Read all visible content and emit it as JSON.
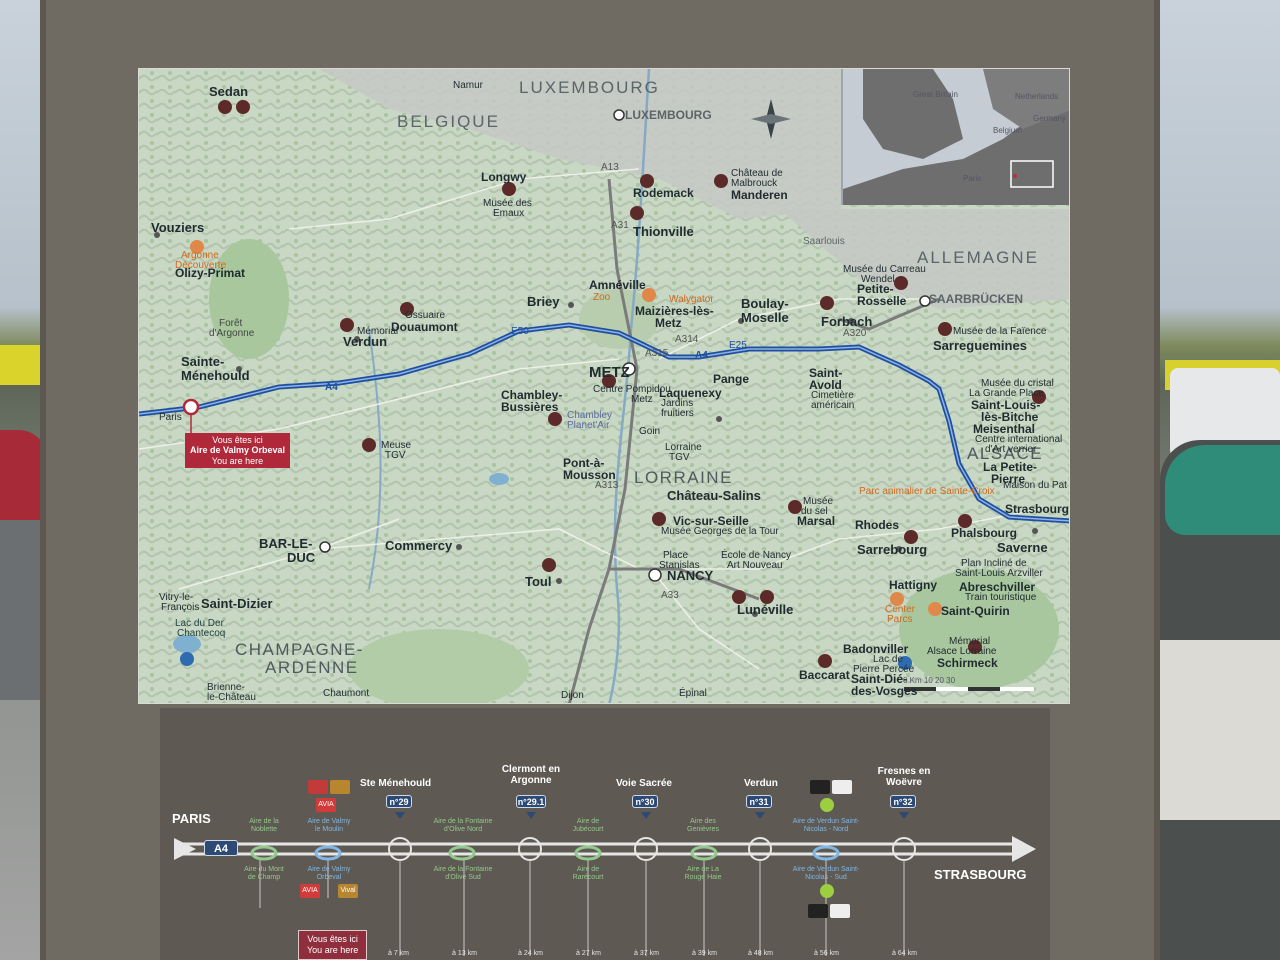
{
  "countries": {
    "luxembourg": "LUXEMBOURG",
    "belgique": "BELGIQUE",
    "allemagne": "ALLEMAGNE"
  },
  "regions": {
    "lorraine": "LORRAINE",
    "alsace": "ALSACE",
    "champagne": "CHAMPAGNE-",
    "ardenne": "ARDENNE"
  },
  "cities": {
    "sedan": "Sedan",
    "luxembourg_city": "LUXEMBOURG",
    "vouziers": "Vouziers",
    "olizy": "Olizy-Primat",
    "longwy": "Longwy",
    "rodemack": "Rodemack",
    "manderen": "Manderen",
    "thionville": "Thionville",
    "briey": "Briey",
    "amneville": "Amnéville",
    "maizieres": "Maizières-lès-",
    "maizieres2": "Metz",
    "boulay": "Boulay-",
    "boulay2": "Moselle",
    "forbach": "Forbach",
    "saarbrucken": "SAARBRÜCKEN",
    "verdun": "Verdun",
    "ste_men": "Sainte-",
    "ste_men2": "Ménehould",
    "metz": "METZ",
    "sarreguemines": "Sarreguemines",
    "chambley": "Chambley-",
    "chambley2": "Bussières",
    "laquenexy": "Laquenexy",
    "pange": "Pange",
    "st_avold": "Saint-",
    "st_avold2": "Avold",
    "pont_mousson": "Pont-à-",
    "pont_mousson2": "Mousson",
    "chateau_salins": "Château-Salins",
    "vic": "Vic-sur-Seille",
    "marsal": "Marsal",
    "rhodes": "Rhodes",
    "sarrebourg": "Sarrebourg",
    "phalsbourg": "Phalsbourg",
    "saverne": "Saverne",
    "strasbourg": "Strasbourg",
    "bar_le_duc": "BAR-LE-",
    "bar_le_duc2": "DUC",
    "commercy": "Commercy",
    "toul": "Toul",
    "nancy": "NANCY",
    "luneville": "Lunéville",
    "hattigny": "Hattigny",
    "abreschviller": "Abreschviller",
    "st_quirin": "Saint-Quirin",
    "st_dizier": "Saint-Dizier",
    "vitry": "Vitry-le-",
    "vitry2": "François",
    "badonviller": "Badonviller",
    "schirmeck": "Schirmeck",
    "baccarat": "Baccarat",
    "st_die": "Saint-Dié-",
    "st_die2": "des-Vosges",
    "chaumont": "Chaumont",
    "dijon": "Dijon",
    "epinal": "Épinal",
    "brienne": "Brienne-",
    "brienne2": "le-Château",
    "namur": "Namur",
    "saarlouis": "Saarlouis",
    "paris": "Paris",
    "la_petite": "La Petite-",
    "pierre": "Pierre"
  },
  "pois": {
    "foret_argonne": "Forêt",
    "foret_argonne2": "d'Argonne",
    "ossuaire": "Ossuaire",
    "douaumont": "Douaumont",
    "memorial": "Mémorial",
    "musee_emaux": "Musée des",
    "musee_emaux2": "Emaux",
    "chateau_malbrouck": "Château de",
    "chateau_malbrouck2": "Malbrouck",
    "zoo": "Zoo",
    "walygator": "Walygator",
    "centre_pompidou": "Centre Pompidou",
    "centre_pompidou2": "Metz",
    "jardins": "Jardins",
    "jardins2": "fruitiers",
    "cimetiere": "Cimetière",
    "cimetiere2": "américain",
    "chambley_planet": "Chambley",
    "chambley_planet2": "Planet'Air",
    "gorin": "Goin",
    "lorraine_tgv": "Lorraine",
    "lorraine_tgv2": "TGV",
    "meuse_tgv": "Meuse",
    "meuse_tgv2": "TGV",
    "musee_carreau": "Musée du Carreau",
    "musee_carreau2": "Wendel",
    "petite_rosselle": "Petite-",
    "petite_rosselle2": "Rosselle",
    "musee_faience": "Musée de la Faïence",
    "musee_cristal": "Musée du cristal",
    "grande_place": "La Grande Place",
    "st_louis": "Saint-Louis-",
    "st_louis2": "lès-Bitche",
    "meisenthal": "Meisenthal",
    "centre_verre": "Centre international",
    "centre_verre2": "d'Art verrier",
    "maison_pat": "Maison du Pat",
    "parc_animalier": "Parc animalier de Sainte-Croix",
    "musee_sel": "Musée",
    "musee_sel2": "du sel",
    "musee_georges": "Musée Georges de la Tour",
    "place_stanislas": "Place",
    "place_stanislas2": "Stanislas",
    "ecole_nancy": "École de Nancy",
    "ecole_nancy2": "Art Nouveau",
    "plan_incline": "Plan Incliné de",
    "plan_incline2": "Saint-Louis Arzviller",
    "train_touristique": "Train touristique",
    "center_parcs": "Center",
    "center_parcs2": "Parcs",
    "memorial_alsace": "Mémorial",
    "memorial_alsace2": "Alsace Lorraine",
    "lac_pierre": "Lac de",
    "lac_pierre2": "Pierre Percée",
    "lac_der": "Lac du Der",
    "lac_der2": "Chantecoq",
    "argonne_decouverte": "Argonne",
    "argonne_decouverte2": "Découverte",
    "magenta_inset": "Great Britain"
  },
  "roads": {
    "a4": "A4",
    "a31": "A31",
    "a314": "A314",
    "a315": "A315",
    "a313": "A313",
    "a33": "A33",
    "a320": "A320",
    "a13": "A13",
    "e25": "E25",
    "e50": "E50"
  },
  "you_are_here_map": {
    "line1": "Vous êtes ici",
    "line2": "Aire de Valmy Orbeval",
    "line3": "You are here"
  },
  "inset": {
    "gb": "Great Britain",
    "netherlands": "Netherlands",
    "belgium": "Belgium",
    "germany": "Germany",
    "paris": "Paris"
  },
  "scale": {
    "label": "0 Km 10 20 30"
  },
  "strip": {
    "start": "PARIS",
    "end": "STRASBOURG",
    "motorway": "A4",
    "exits": [
      {
        "name": "Ste Ménehould",
        "num": "n°29"
      },
      {
        "name": "Clermont en Argonne",
        "num": "n°29.1"
      },
      {
        "name": "Voie Sacrée",
        "num": "n°30"
      },
      {
        "name": "Verdun",
        "num": "n°31"
      },
      {
        "name": "Fresnes en Woëvre",
        "num": "n°32"
      }
    ],
    "top_areas": [
      "Aire de la Noblette",
      "Aire de Valmy le Moulin",
      "Aire de la Fontaine d'Olive Nord",
      "Aire de Jubécourt",
      "Aire des Genièvres",
      "Aire de Verdun Saint-Nicolas - Nord"
    ],
    "bottom_areas": [
      "Aire du Mont de Champ",
      "Aire de Valmy Orbeval",
      "Aire de la Fontaine d'Olive Sud",
      "Aire de Rarécourt",
      "Aire de La Rouge Haie",
      "Aire de Verdun Saint-Nicolas - Sud"
    ],
    "distances": [
      "à 7 km",
      "à 13 km",
      "à 24 km",
      "à 27 km",
      "à 37 km",
      "à 39 km",
      "à 48 km",
      "à 56 km",
      "à 64 km"
    ],
    "brands": {
      "avia": "AVIA",
      "vival": "Vival"
    },
    "you_are_here": {
      "line1": "Vous êtes ici",
      "line2": "You are here"
    }
  }
}
